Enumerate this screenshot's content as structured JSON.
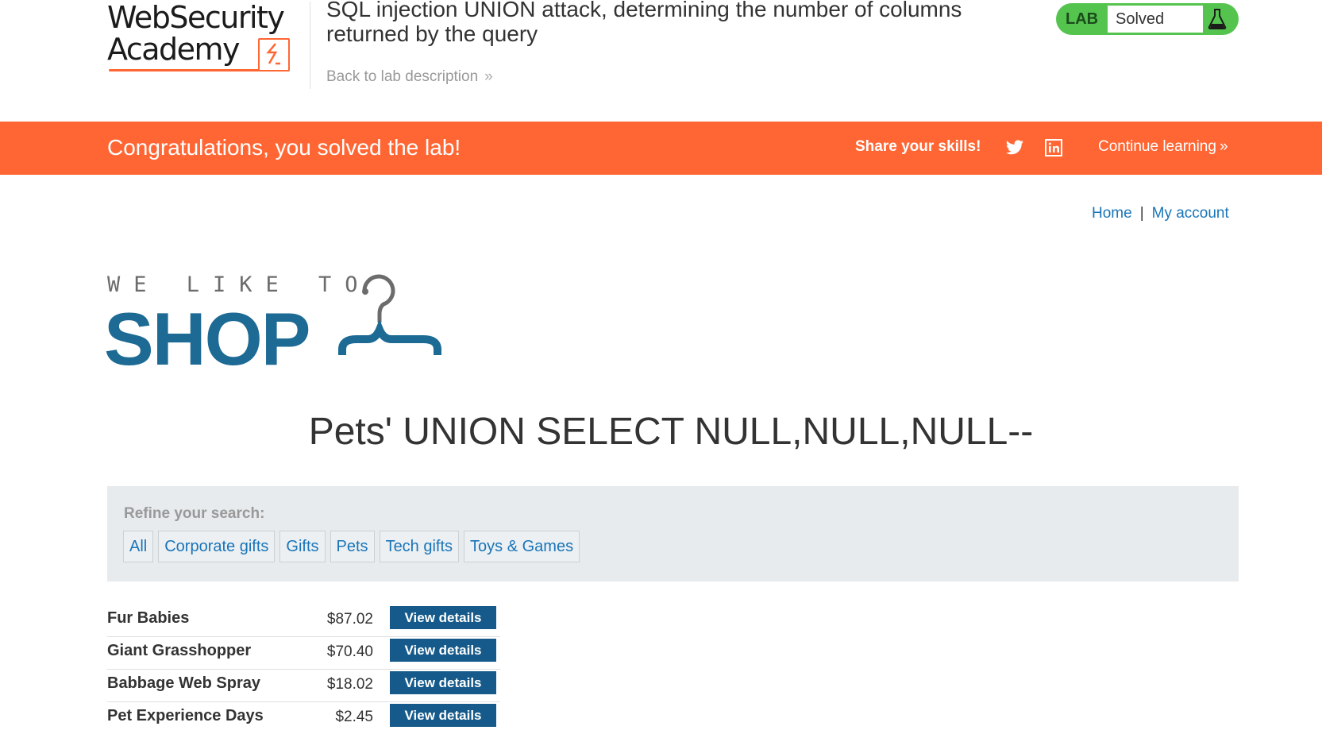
{
  "header": {
    "logo_line1": "WebSecurity",
    "logo_line2": "Academy",
    "lab_title": "SQL injection UNION attack, determining the number of columns returned by the query",
    "back_link": "Back to lab description",
    "lab_badge": {
      "label": "LAB",
      "status": "Solved",
      "color": "#54c44f"
    }
  },
  "banner": {
    "message": "Congratulations, you solved the lab!",
    "share_label": "Share your skills!",
    "continue_label": "Continue learning",
    "color": "#ff6633"
  },
  "nav": {
    "home": "Home",
    "separator": "|",
    "account": "My account"
  },
  "shop_logo": {
    "tagline": "WE LIKE TO",
    "word": "SHOP"
  },
  "search_heading": "Pets' UNION SELECT NULL,NULL,NULL--",
  "filter": {
    "label": "Refine your search:",
    "categories": [
      "All",
      "Corporate gifts",
      "Gifts",
      "Pets",
      "Tech gifts",
      "Toys & Games"
    ]
  },
  "products": [
    {
      "name": "Fur Babies",
      "price": "$87.02",
      "button": "View details"
    },
    {
      "name": "Giant Grasshopper",
      "price": "$70.40",
      "button": "View details"
    },
    {
      "name": "Babbage Web Spray",
      "price": "$18.02",
      "button": "View details"
    },
    {
      "name": "Pet Experience Days",
      "price": "$2.45",
      "button": "View details"
    }
  ]
}
